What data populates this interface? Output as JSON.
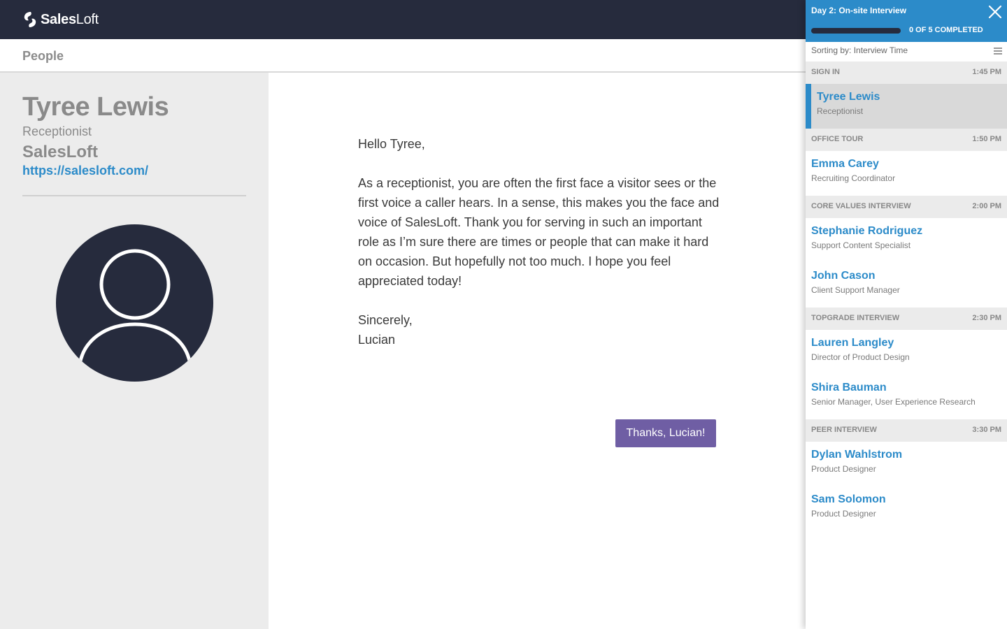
{
  "app": {
    "brand": "SalesLoft",
    "brand_bold": "Sales",
    "brand_light": "Loft",
    "section_title": "People"
  },
  "person": {
    "name": "Tyree Lewis",
    "role": "Receptionist",
    "company": "SalesLoft",
    "url": "https://salesloft.com/"
  },
  "letter": {
    "greeting": "Hello Tyree,",
    "body": "As a receptionist, you are often the first face a visitor sees or the first voice a caller hears. In a sense, this makes you the face and voice of SalesLoft. Thank you for serving in such an important role as I’m sure there are times or people that can make it hard on occasion. But hopefully not too much. I hope you feel appreciated today!",
    "closing": "Sincerely,",
    "signature": "Lucian",
    "button_label": "Thanks, Lucian!"
  },
  "sidebar": {
    "title": "Day 2: On-site Interview",
    "progress_text": "0 OF 5 COMPLETED",
    "progress_fraction": 0,
    "sort_text": "Sorting by: Interview Time",
    "sections": [
      {
        "label": "SIGN IN",
        "time": "1:45 PM",
        "people": [
          {
            "name": "Tyree Lewis",
            "role": "Receptionist",
            "active": true
          }
        ]
      },
      {
        "label": "OFFICE TOUR",
        "time": "1:50 PM",
        "people": [
          {
            "name": "Emma Carey",
            "role": "Recruiting Coordinator"
          }
        ]
      },
      {
        "label": "CORE VALUES INTERVIEW",
        "time": "2:00 PM",
        "people": [
          {
            "name": "Stephanie Rodriguez",
            "role": "Support Content Specialist"
          },
          {
            "name": "John Cason",
            "role": "Client Support Manager"
          }
        ]
      },
      {
        "label": "TOPGRADE INTERVIEW",
        "time": "2:30 PM",
        "people": [
          {
            "name": "Lauren Langley",
            "role": "Director of Product Design"
          },
          {
            "name": "Shira Bauman",
            "role": "Senior Manager, User Experience Research"
          }
        ]
      },
      {
        "label": "PEER INTERVIEW",
        "time": "3:30 PM",
        "people": [
          {
            "name": "Dylan Wahlstrom",
            "role": "Product Designer"
          },
          {
            "name": "Sam Solomon",
            "role": "Product Designer"
          }
        ]
      }
    ]
  },
  "icons": {
    "logo": "salesloft-logo-icon",
    "close": "close-icon",
    "menu": "hamburger-menu-icon",
    "avatar": "user-avatar-icon"
  },
  "colors": {
    "navy": "#262b3d",
    "accent_blue": "#2c8bc9",
    "button_purple": "#6f5ea4"
  }
}
